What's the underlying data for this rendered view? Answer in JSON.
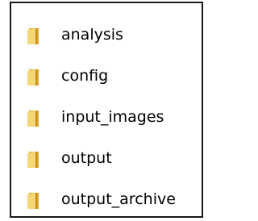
{
  "folders": [
    {
      "label": "analysis",
      "icon": "folder-icon"
    },
    {
      "label": "config",
      "icon": "folder-icon"
    },
    {
      "label": "input_images",
      "icon": "folder-icon"
    },
    {
      "label": "output",
      "icon": "folder-icon"
    },
    {
      "label": "output_archive",
      "icon": "folder-icon"
    }
  ],
  "colors": {
    "folder_front": "#f5d67a",
    "folder_back": "#e0a62a",
    "folder_edge": "#c98c12",
    "text": "#000000",
    "border": "#1a1a1a"
  }
}
